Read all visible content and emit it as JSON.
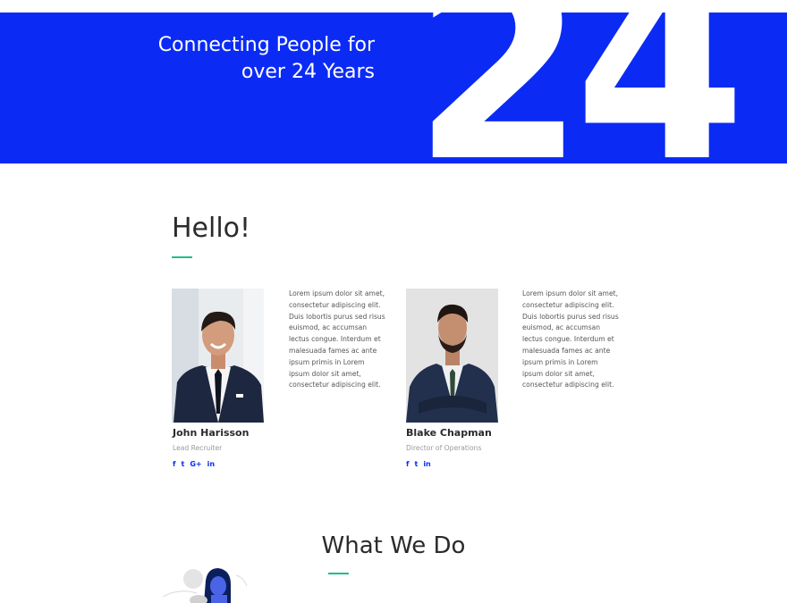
{
  "hero": {
    "title_line1": "Connecting People for",
    "title_line2": "over 24 Years",
    "big_number": "24",
    "background_color": "#0b2bf5"
  },
  "about": {
    "heading": "Hello!",
    "accent_color": "#1dbf8a",
    "team": [
      {
        "name": "John Harisson",
        "role": "Lead Recruiter",
        "bio": "Lorem ipsum dolor sit amet, consectetur adipiscing elit. Duis lobortis purus sed risus euismod, ac accumsan lectus congue. Interdum et malesuada fames ac ante ipsum primis in Lorem ipsum dolor sit amet, consectetur adipiscing elit.",
        "socials": [
          {
            "icon": "facebook-icon",
            "glyph": "f"
          },
          {
            "icon": "twitter-icon",
            "glyph": "t"
          },
          {
            "icon": "google-plus-icon",
            "glyph": "G+"
          },
          {
            "icon": "linkedin-icon",
            "glyph": "in"
          }
        ]
      },
      {
        "name": "Blake Chapman",
        "role": "Director of Operations",
        "bio": "Lorem ipsum dolor sit amet, consectetur adipiscing elit. Duis lobortis purus sed risus euismod, ac accumsan lectus congue. Interdum et malesuada fames ac ante ipsum primis in Lorem ipsum dolor sit amet, consectetur adipiscing elit.",
        "socials": [
          {
            "icon": "facebook-icon",
            "glyph": "f"
          },
          {
            "icon": "twitter-icon",
            "glyph": "t"
          },
          {
            "icon": "linkedin-icon",
            "glyph": "in"
          }
        ]
      }
    ]
  },
  "services": {
    "heading": "What We Do"
  }
}
